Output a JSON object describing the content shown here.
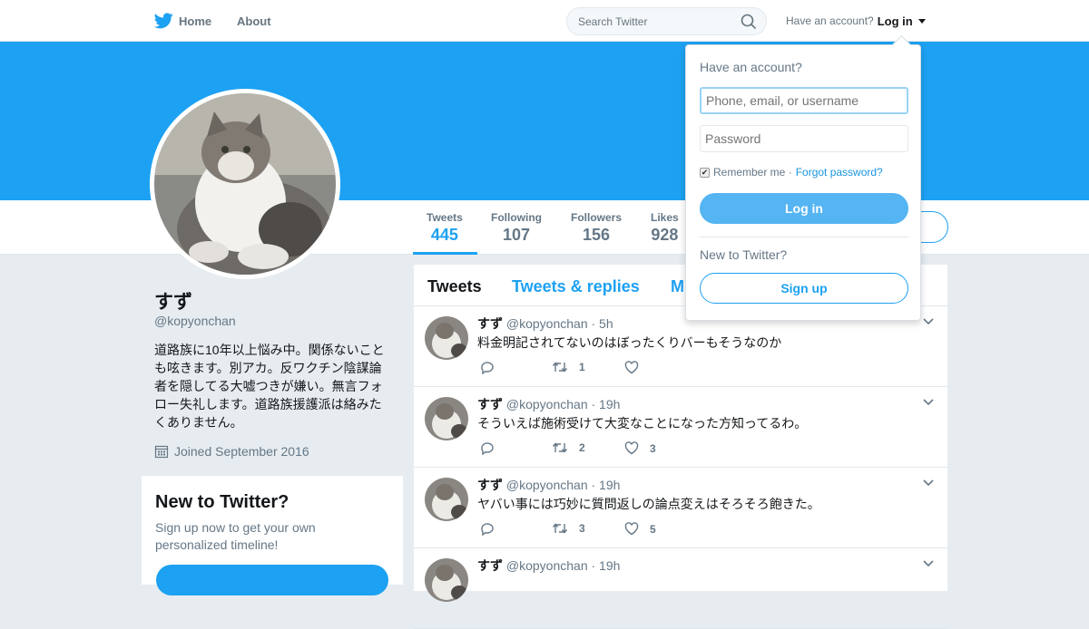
{
  "nav": {
    "home_label": "Home",
    "about_label": "About",
    "search_placeholder": "Search Twitter",
    "have_account_text": "Have an account?",
    "login_label": "Log in"
  },
  "colors": {
    "brand": "#1da1f2",
    "text": "#14171a",
    "muted": "#657786"
  },
  "profile": {
    "name": "すず",
    "handle": "@kopyonchan",
    "bio": "道路族に10年以上悩み中。関係ないことも呟きます。別アカ。反ワクチン陰謀論者を隠してる大嘘つきが嫌い。無言フォロー失礼します。道路族援護派は絡みたくありません。",
    "joined": "Joined September 2016"
  },
  "stats": [
    {
      "label": "Tweets",
      "value": "445"
    },
    {
      "label": "Following",
      "value": "107"
    },
    {
      "label": "Followers",
      "value": "156"
    },
    {
      "label": "Likes",
      "value": "928"
    }
  ],
  "new_to_twitter": {
    "title": "New to Twitter?",
    "subtitle": "Sign up now to get your own personalized timeline!"
  },
  "timeline": {
    "tabs": [
      "Tweets",
      "Tweets & replies",
      "M"
    ],
    "tweets": [
      {
        "name": "すず",
        "handle": "@kopyonchan",
        "time": "· 5h",
        "text": "料金明記されてないのはぼったくりバーもそうなのか",
        "retweets": "1",
        "likes": ""
      },
      {
        "name": "すず",
        "handle": "@kopyonchan",
        "time": "· 19h",
        "text": "そういえば施術受けて大変なことになった方知ってるわ。",
        "retweets": "2",
        "likes": "3"
      },
      {
        "name": "すず",
        "handle": "@kopyonchan",
        "time": "· 19h",
        "text": "ヤバい事には巧妙に質問返しの論点変えはそろそろ飽きた。",
        "retweets": "3",
        "likes": "5"
      },
      {
        "name": "すず",
        "handle": "@kopyonchan",
        "time": "· 19h",
        "text": "",
        "retweets": "",
        "likes": ""
      }
    ]
  },
  "login_dropdown": {
    "title": "Have an account?",
    "username_placeholder": "Phone, email, or username",
    "password_placeholder": "Password",
    "remember_label": "Remember me ·",
    "forgot_label": "Forgot password?",
    "login_button": "Log in",
    "new_label": "New to Twitter?",
    "signup_button": "Sign up"
  }
}
